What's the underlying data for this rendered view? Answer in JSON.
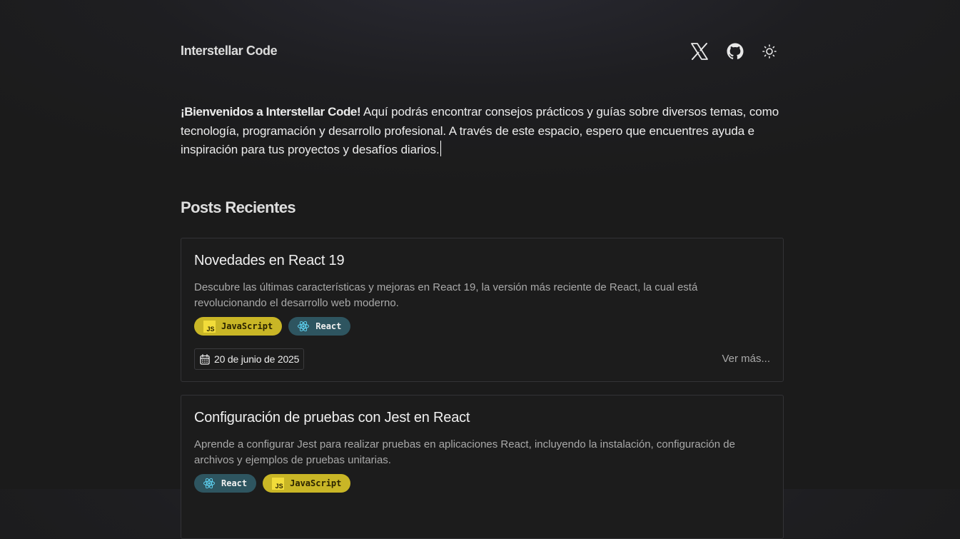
{
  "header": {
    "brand": "Interstellar Code",
    "icons": [
      "x-twitter-icon",
      "github-icon",
      "sun-icon"
    ]
  },
  "intro": {
    "bold": "¡Bienvenidos a Interstellar Code!",
    "text": " Aquí podrás encontrar consejos prácticos y guías sobre diversos temas, como tecnología, programación y desarrollo profesional. A través de este espacio, espero que encuentres ayuda e inspiración para tus proyectos y desafíos diarios."
  },
  "section": {
    "title": "Posts Recientes"
  },
  "posts": [
    {
      "title": "Novedades en React 19",
      "description": "Descubre las últimas características y mejoras en React 19, la versión más reciente de React, la cual está revolucionando el desarrollo web moderno.",
      "tags": [
        "JavaScript",
        "React"
      ],
      "date": "20 de junio de 2025",
      "more": "Ver más..."
    },
    {
      "title": "Configuración de pruebas con Jest en React",
      "description": "Aprende a configurar Jest para realizar pruebas en aplicaciones React, incluyendo la instalación, configuración de archivos y ejemplos de pruebas unitarias.",
      "tags": [
        "React",
        "JavaScript"
      ]
    }
  ],
  "colors": {
    "background": "#1b1b1b",
    "tag_js": "#c9b626",
    "tag_react": "#2e5560"
  }
}
